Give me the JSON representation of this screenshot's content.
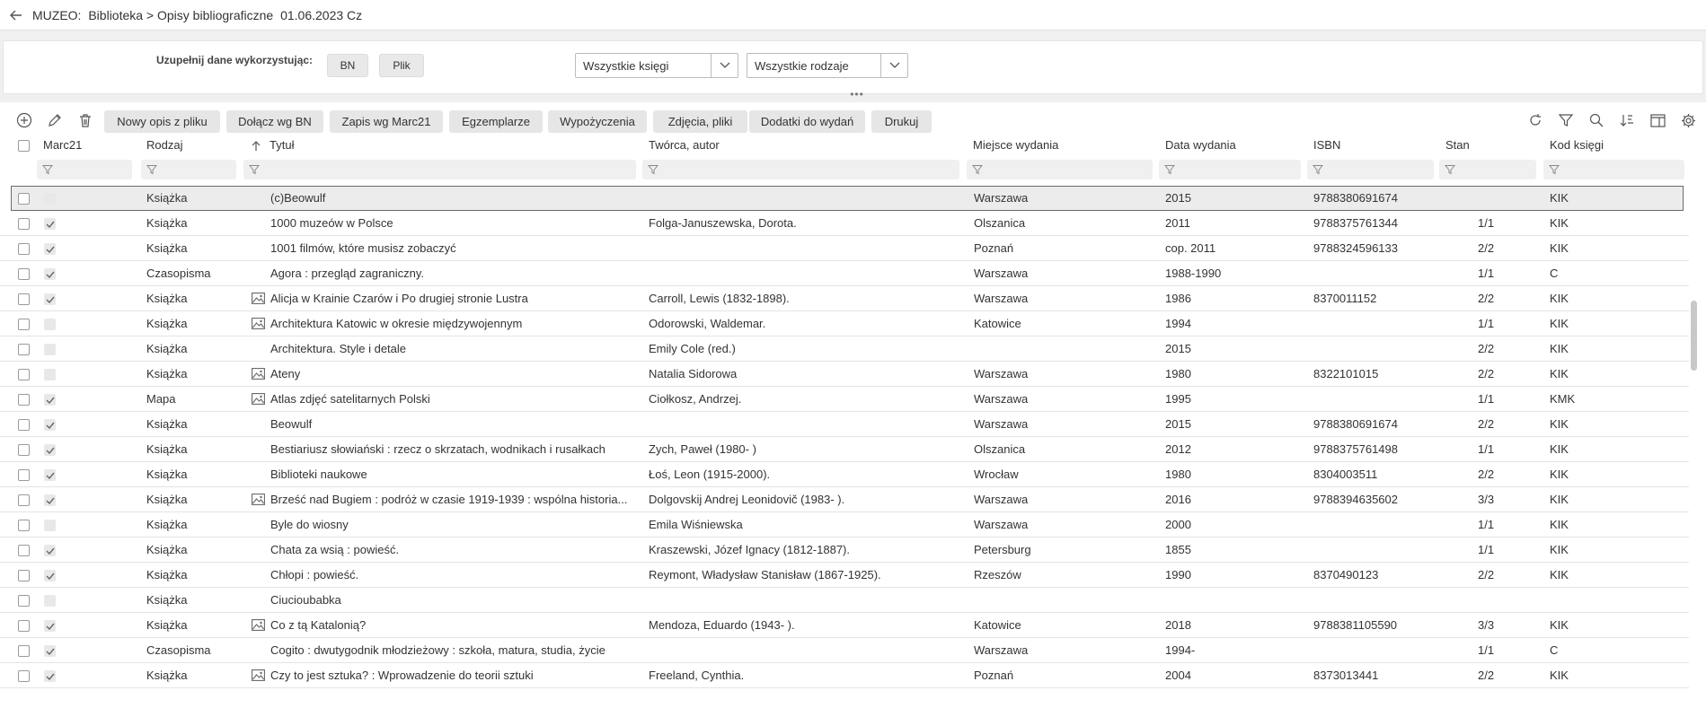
{
  "header": {
    "app": "MUZEO:",
    "path": "Biblioteka > Opisy bibliograficzne",
    "date": "01.06.2023 Cz"
  },
  "filters": {
    "label": "Uzupełnij dane wykorzystując:",
    "btn_bn": "BN",
    "btn_plik": "Plik",
    "select_ksiegi": "Wszystkie księgi",
    "select_rodzaje": "Wszystkie rodzaje"
  },
  "toolbar": {
    "buttons": [
      "Nowy opis z pliku",
      "Dołącz wg BN",
      "Zapis wg Marc21",
      "Egzemplarze",
      "Wypożyczenia",
      "Zdjęcia, pliki",
      "Dodatki do wydań",
      "Drukuj"
    ]
  },
  "columns": {
    "marc21": "Marc21",
    "rodzaj": "Rodzaj",
    "tytul": "Tytuł",
    "tworca": "Twórca, autor",
    "miejsce": "Miejsce wydania",
    "data": "Data wydania",
    "isbn": "ISBN",
    "stan": "Stan",
    "kod": "Kod księgi"
  },
  "rows": [
    {
      "marc": false,
      "rodzaj": "Książka",
      "img": false,
      "tytul": "(c)Beowulf",
      "tworca": "",
      "miejsce": "Warszawa",
      "data": "2015",
      "isbn": "9788380691674",
      "stan": "",
      "kod": "KIK",
      "selected": true
    },
    {
      "marc": true,
      "rodzaj": "Książka",
      "img": false,
      "tytul": "1000 muzeów w Polsce",
      "tworca": "Folga-Januszewska, Dorota.",
      "miejsce": "Olszanica",
      "data": "2011",
      "isbn": "9788375761344",
      "stan": "1/1",
      "kod": "KIK"
    },
    {
      "marc": true,
      "rodzaj": "Książka",
      "img": false,
      "tytul": "1001 filmów, które musisz zobaczyć",
      "tworca": "",
      "miejsce": "Poznań",
      "data": "cop. 2011",
      "isbn": "9788324596133",
      "stan": "2/2",
      "kod": "KIK"
    },
    {
      "marc": true,
      "rodzaj": "Czasopisma",
      "img": false,
      "tytul": "Agora : przegląd zagraniczny.",
      "tworca": "",
      "miejsce": "Warszawa",
      "data": "1988-1990",
      "isbn": "",
      "stan": "1/1",
      "kod": "C"
    },
    {
      "marc": true,
      "rodzaj": "Książka",
      "img": true,
      "tytul": "Alicja w Krainie Czarów i Po drugiej stronie Lustra",
      "tworca": "Carroll, Lewis (1832-1898).",
      "miejsce": "Warszawa",
      "data": "1986",
      "isbn": "8370011152",
      "stan": "2/2",
      "kod": "KIK"
    },
    {
      "marc": false,
      "rodzaj": "Książka",
      "img": true,
      "tytul": "Architektura Katowic w okresie międzywojennym",
      "tworca": "Odorowski, Waldemar.",
      "miejsce": "Katowice",
      "data": "1994",
      "isbn": "",
      "stan": "1/1",
      "kod": "KIK"
    },
    {
      "marc": false,
      "rodzaj": "Książka",
      "img": false,
      "tytul": "Architektura. Style i detale",
      "tworca": "Emily Cole (red.)",
      "miejsce": "",
      "data": "2015",
      "isbn": "",
      "stan": "2/2",
      "kod": "KIK"
    },
    {
      "marc": false,
      "rodzaj": "Książka",
      "img": true,
      "tytul": "Ateny",
      "tworca": "Natalia Sidorowa",
      "miejsce": "Warszawa",
      "data": "1980",
      "isbn": "8322101015",
      "stan": "2/2",
      "kod": "KIK"
    },
    {
      "marc": true,
      "rodzaj": "Mapa",
      "img": true,
      "tytul": "Atlas zdjęć satelitarnych Polski",
      "tworca": "Ciołkosz, Andrzej.",
      "miejsce": "Warszawa",
      "data": "1995",
      "isbn": "",
      "stan": "1/1",
      "kod": "KMK"
    },
    {
      "marc": true,
      "rodzaj": "Książka",
      "img": false,
      "tytul": "Beowulf",
      "tworca": "",
      "miejsce": "Warszawa",
      "data": "2015",
      "isbn": "9788380691674",
      "stan": "2/2",
      "kod": "KIK"
    },
    {
      "marc": true,
      "rodzaj": "Książka",
      "img": false,
      "tytul": "Bestiariusz słowiański : rzecz o skrzatach, wodnikach i rusałkach",
      "tworca": "Zych, Paweł (1980- )",
      "miejsce": "Olszanica",
      "data": "2012",
      "isbn": "9788375761498",
      "stan": "1/1",
      "kod": "KIK"
    },
    {
      "marc": true,
      "rodzaj": "Książka",
      "img": false,
      "tytul": "Biblioteki naukowe",
      "tworca": "Łoś, Leon (1915-2000).",
      "miejsce": "Wrocław",
      "data": "1980",
      "isbn": "8304003511",
      "stan": "2/2",
      "kod": "KIK"
    },
    {
      "marc": true,
      "rodzaj": "Książka",
      "img": true,
      "tytul": "Brześć nad Bugiem : podróż w czasie 1919-1939 : wspólna historia...",
      "tworca": "Dolgovskij Andrej Leonidovič (1983- ).",
      "miejsce": "Warszawa",
      "data": "2016",
      "isbn": "9788394635602",
      "stan": "3/3",
      "kod": "KIK"
    },
    {
      "marc": false,
      "rodzaj": "Książka",
      "img": false,
      "tytul": "Byle do wiosny",
      "tworca": "Emila Wiśniewska",
      "miejsce": "Warszawa",
      "data": "2000",
      "isbn": "",
      "stan": "1/1",
      "kod": "KIK"
    },
    {
      "marc": true,
      "rodzaj": "Książka",
      "img": false,
      "tytul": "Chata za wsią : powieść.",
      "tworca": "Kraszewski, Józef Ignacy (1812-1887).",
      "miejsce": "Petersburg",
      "data": "1855",
      "isbn": "",
      "stan": "1/1",
      "kod": "KIK"
    },
    {
      "marc": true,
      "rodzaj": "Książka",
      "img": false,
      "tytul": "Chłopi : powieść.",
      "tworca": "Reymont, Władysław Stanisław (1867-1925).",
      "miejsce": "Rzeszów",
      "data": "1990",
      "isbn": "8370490123",
      "stan": "2/2",
      "kod": "KIK"
    },
    {
      "marc": false,
      "rodzaj": "Książka",
      "img": false,
      "tytul": "Ciucioubabka",
      "tworca": "",
      "miejsce": "",
      "data": "",
      "isbn": "",
      "stan": "",
      "kod": ""
    },
    {
      "marc": true,
      "rodzaj": "Książka",
      "img": true,
      "tytul": "Co z tą Katalonią?",
      "tworca": "Mendoza, Eduardo (1943- ).",
      "miejsce": "Katowice",
      "data": "2018",
      "isbn": "9788381105590",
      "stan": "3/3",
      "kod": "KIK"
    },
    {
      "marc": true,
      "rodzaj": "Czasopisma",
      "img": false,
      "tytul": "Cogito : dwutygodnik młodzieżowy : szkoła, matura, studia, życie",
      "tworca": "",
      "miejsce": "Warszawa",
      "data": "1994-",
      "isbn": "",
      "stan": "1/1",
      "kod": "C"
    },
    {
      "marc": true,
      "rodzaj": "Książka",
      "img": true,
      "tytul": "Czy to jest sztuka? :  Wprowadzenie do teorii sztuki",
      "tworca": "Freeland, Cynthia.",
      "miejsce": "Poznań",
      "data": "2004",
      "isbn": "8373013441",
      "stan": "2/2",
      "kod": "KIK"
    }
  ]
}
